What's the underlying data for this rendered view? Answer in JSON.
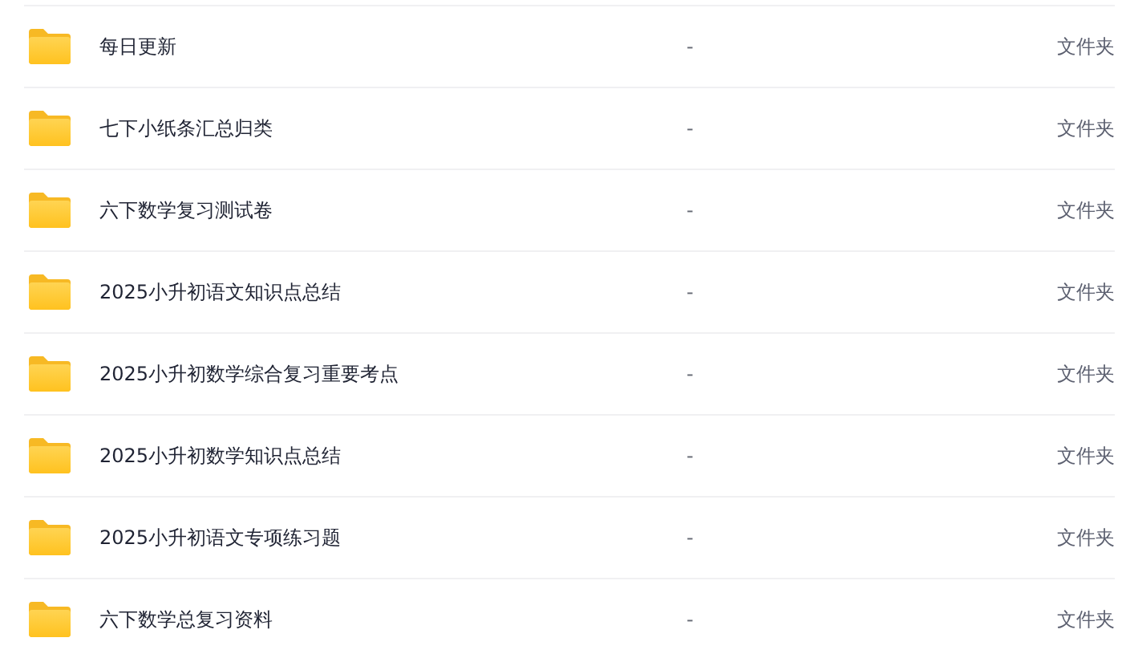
{
  "files": [
    {
      "name": "每日更新",
      "size": "-",
      "type": "文件夹"
    },
    {
      "name": "七下小纸条汇总归类",
      "size": "-",
      "type": "文件夹"
    },
    {
      "name": "六下数学复习测试卷",
      "size": "-",
      "type": "文件夹"
    },
    {
      "name": "2025小升初语文知识点总结",
      "size": "-",
      "type": "文件夹"
    },
    {
      "name": "2025小升初数学综合复习重要考点",
      "size": "-",
      "type": "文件夹"
    },
    {
      "name": "2025小升初数学知识点总结",
      "size": "-",
      "type": "文件夹"
    },
    {
      "name": "2025小升初语文专项练习题",
      "size": "-",
      "type": "文件夹"
    },
    {
      "name": "六下数学总复习资料",
      "size": "-",
      "type": "文件夹"
    }
  ]
}
